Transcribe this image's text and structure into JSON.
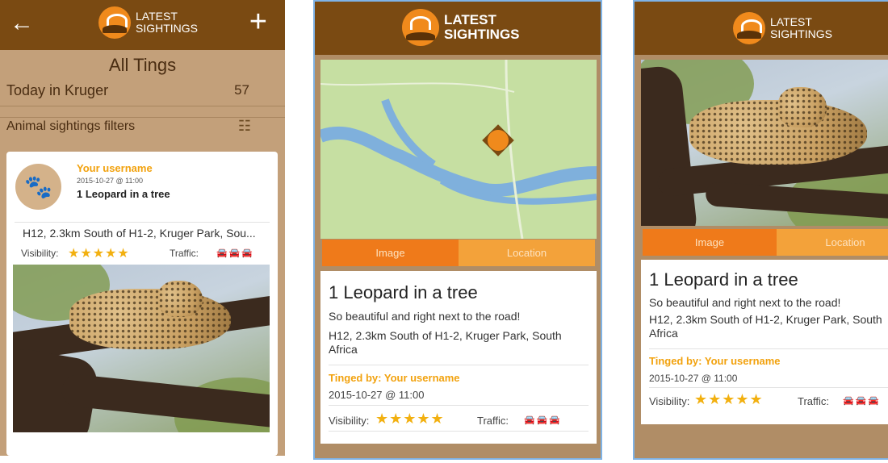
{
  "brand": {
    "line1": "LATEST",
    "line2": "SIGHTINGS"
  },
  "list_screen": {
    "title": "All Tings",
    "today_label": "Today in Kruger",
    "today_count": "57",
    "filters_label": "Animal sightings filters",
    "item": {
      "username": "Your username",
      "timestamp": "2015-10-27 @ 11:00",
      "sighting": "1 Leopard in a tree",
      "location": "H12, 2.3km South of H1-2, Kruger Park, Sou...",
      "visibility_label": "Visibility:",
      "visibility_stars": "★★★★★",
      "traffic_label": "Traffic:",
      "traffic_level": 1
    }
  },
  "detail": {
    "tab_image": "Image",
    "tab_location": "Location",
    "title": "1 Leopard in a tree",
    "description": "So beautiful and right next to the road!",
    "location": "H12, 2.3km South of H1-2, Kruger Park, South Africa",
    "tinged_by": "Tinged by: Your username",
    "timestamp": "2015-10-27 @ 11:00",
    "visibility_label": "Visibility:",
    "visibility_stars": "★★★★★",
    "traffic_label": "Traffic:",
    "traffic_level": 1
  },
  "colors": {
    "header": "#7a4a12",
    "accent": "#f2a20e",
    "tab_active": "#ef7a1a",
    "tab_inactive": "#f3a23a"
  }
}
